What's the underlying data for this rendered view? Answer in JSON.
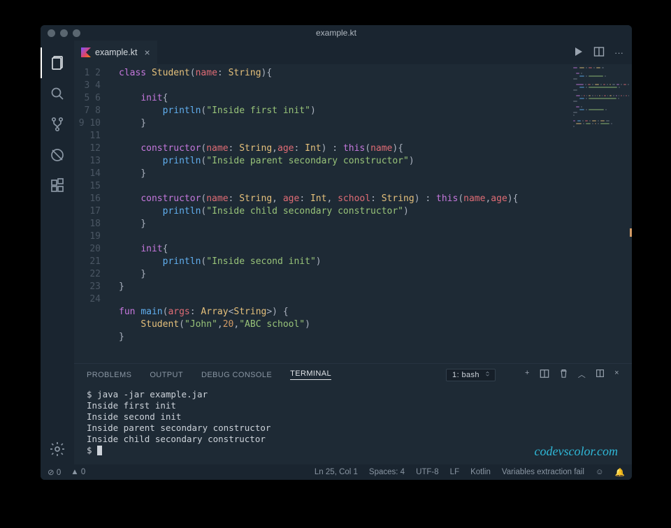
{
  "window": {
    "title": "example.kt"
  },
  "tab": {
    "filename": "example.kt"
  },
  "activity": [
    "explorer",
    "search",
    "scm",
    "debug",
    "extensions"
  ],
  "gutter_start": 1,
  "gutter_end": 24,
  "code_lines": [
    [
      [
        "kw",
        "class"
      ],
      [
        "pn",
        " "
      ],
      [
        "ty",
        "Student"
      ],
      [
        "pn",
        "("
      ],
      [
        "pm",
        "name"
      ],
      [
        "pn",
        ": "
      ],
      [
        "ty",
        "String"
      ],
      [
        "pn",
        "){"
      ]
    ],
    [],
    [
      [
        "pn",
        "    "
      ],
      [
        "kw",
        "init"
      ],
      [
        "pn",
        "{"
      ]
    ],
    [
      [
        "pn",
        "        "
      ],
      [
        "fn",
        "println"
      ],
      [
        "pn",
        "("
      ],
      [
        "st",
        "\"Inside first init\""
      ],
      [
        "pn",
        ")"
      ]
    ],
    [
      [
        "pn",
        "    }"
      ]
    ],
    [],
    [
      [
        "pn",
        "    "
      ],
      [
        "kw",
        "constructor"
      ],
      [
        "pn",
        "("
      ],
      [
        "pm",
        "name"
      ],
      [
        "pn",
        ": "
      ],
      [
        "ty",
        "String"
      ],
      [
        "pn",
        ","
      ],
      [
        "pm",
        "age"
      ],
      [
        "pn",
        ": "
      ],
      [
        "ty",
        "Int"
      ],
      [
        "pn",
        ") : "
      ],
      [
        "th",
        "this"
      ],
      [
        "pn",
        "("
      ],
      [
        "pm",
        "name"
      ],
      [
        "pn",
        "){"
      ]
    ],
    [
      [
        "pn",
        "        "
      ],
      [
        "fn",
        "println"
      ],
      [
        "pn",
        "("
      ],
      [
        "st",
        "\"Inside parent secondary constructor\""
      ],
      [
        "pn",
        ")"
      ]
    ],
    [
      [
        "pn",
        "    }"
      ]
    ],
    [],
    [
      [
        "pn",
        "    "
      ],
      [
        "kw",
        "constructor"
      ],
      [
        "pn",
        "("
      ],
      [
        "pm",
        "name"
      ],
      [
        "pn",
        ": "
      ],
      [
        "ty",
        "String"
      ],
      [
        "pn",
        ", "
      ],
      [
        "pm",
        "age"
      ],
      [
        "pn",
        ": "
      ],
      [
        "ty",
        "Int"
      ],
      [
        "pn",
        ", "
      ],
      [
        "pm",
        "school"
      ],
      [
        "pn",
        ": "
      ],
      [
        "ty",
        "String"
      ],
      [
        "pn",
        ") : "
      ],
      [
        "th",
        "this"
      ],
      [
        "pn",
        "("
      ],
      [
        "pm",
        "name"
      ],
      [
        "pn",
        ","
      ],
      [
        "pm",
        "age"
      ],
      [
        "pn",
        "){"
      ]
    ],
    [
      [
        "pn",
        "        "
      ],
      [
        "fn",
        "println"
      ],
      [
        "pn",
        "("
      ],
      [
        "st",
        "\"Inside child secondary constructor\""
      ],
      [
        "pn",
        ")"
      ]
    ],
    [
      [
        "pn",
        "    }"
      ]
    ],
    [],
    [
      [
        "pn",
        "    "
      ],
      [
        "kw",
        "init"
      ],
      [
        "pn",
        "{"
      ]
    ],
    [
      [
        "pn",
        "        "
      ],
      [
        "fn",
        "println"
      ],
      [
        "pn",
        "("
      ],
      [
        "st",
        "\"Inside second init\""
      ],
      [
        "pn",
        ")"
      ]
    ],
    [
      [
        "pn",
        "    }"
      ]
    ],
    [
      [
        "pn",
        "}"
      ]
    ],
    [],
    [
      [
        "kw",
        "fun"
      ],
      [
        "pn",
        " "
      ],
      [
        "fn",
        "main"
      ],
      [
        "pn",
        "("
      ],
      [
        "pm",
        "args"
      ],
      [
        "pn",
        ": "
      ],
      [
        "ty",
        "Array"
      ],
      [
        "pn",
        "<"
      ],
      [
        "ty",
        "String"
      ],
      [
        "pn",
        ">) {"
      ]
    ],
    [
      [
        "pn",
        "    "
      ],
      [
        "ty",
        "Student"
      ],
      [
        "pn",
        "("
      ],
      [
        "st",
        "\"John\""
      ],
      [
        "pn",
        ","
      ],
      [
        "nm",
        "20"
      ],
      [
        "pn",
        ","
      ],
      [
        "st",
        "\"ABC school\""
      ],
      [
        "pn",
        ")"
      ]
    ],
    [
      [
        "pn",
        "}"
      ]
    ],
    [],
    []
  ],
  "panel": {
    "tabs": [
      "PROBLEMS",
      "OUTPUT",
      "DEBUG CONSOLE",
      "TERMINAL"
    ],
    "active": 3,
    "terminal_selector": "1: bash"
  },
  "terminal_lines": [
    "$ java -jar example.jar",
    "Inside first init",
    "Inside second init",
    "Inside parent secondary constructor",
    "Inside child secondary constructor"
  ],
  "terminal_prompt": "$ ",
  "status": {
    "errors": "0",
    "warnings": "0",
    "lncol": "Ln 25, Col 1",
    "spaces": "Spaces: 4",
    "encoding": "UTF-8",
    "eol": "LF",
    "lang": "Kotlin",
    "extra": "Variables extraction fail"
  },
  "watermark": "codevscolor.com"
}
